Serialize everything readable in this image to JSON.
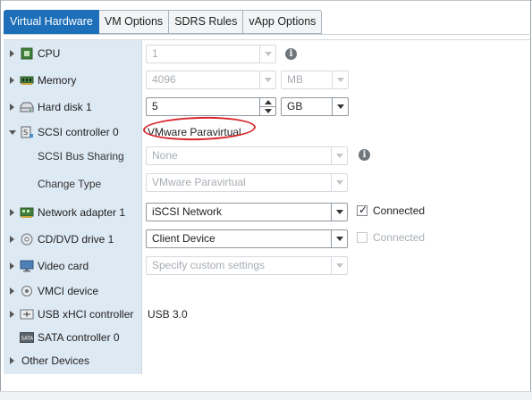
{
  "tabs": [
    {
      "label": "Virtual Hardware",
      "active": true
    },
    {
      "label": "VM Options"
    },
    {
      "label": "SDRS Rules"
    },
    {
      "label": "vApp Options"
    }
  ],
  "rows": {
    "cpu": {
      "label": "CPU",
      "value": "1",
      "icon": "cpu-icon"
    },
    "memory": {
      "label": "Memory",
      "value": "4096",
      "unit": "MB",
      "icon": "memory-icon"
    },
    "hard_disk": {
      "label": "Hard disk 1",
      "value": "5",
      "unit": "GB",
      "icon": "hard-disk-icon"
    },
    "scsi": {
      "label": "SCSI controller 0",
      "value": "VMware Paravirtual",
      "icon": "scsi-controller-icon"
    },
    "scsi_bus_sharing": {
      "label": "SCSI Bus Sharing",
      "value": "None"
    },
    "change_type": {
      "label": "Change Type",
      "value": "VMware Paravirtual"
    },
    "network": {
      "label": "Network adapter 1",
      "value": "iSCSI Network",
      "connected_label": "Connected",
      "connected": true,
      "icon": "network-adapter-icon"
    },
    "cddvd": {
      "label": "CD/DVD drive 1",
      "value": "Client Device",
      "connected_label": "Connected",
      "connected": false,
      "icon": "cd-dvd-icon"
    },
    "video": {
      "label": "Video card",
      "value": "Specify custom settings",
      "icon": "monitor-icon"
    },
    "vmci": {
      "label": "VMCI device",
      "icon": "vmci-icon"
    },
    "usb": {
      "label": "USB xHCI controller",
      "value": "USB 3.0",
      "icon": "usb-icon"
    },
    "sata": {
      "label": "SATA controller 0",
      "icon": "sata-icon",
      "icon_text": "SATA"
    },
    "other": {
      "label": "Other Devices"
    }
  },
  "colors": {
    "active_tab": "#1c6fb8",
    "label_column": "#dde9f3",
    "annotation": "#d8262b"
  }
}
